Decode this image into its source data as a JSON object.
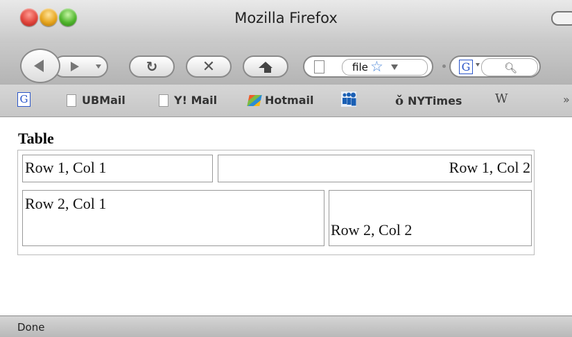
{
  "window": {
    "title": "Mozilla Firefox"
  },
  "toolbar": {
    "url_text": "file",
    "search_engine_glyph": "G",
    "icons": [
      "back-arrow-icon",
      "forward-arrow-icon",
      "reload-icon",
      "stop-icon",
      "home-icon",
      "bookmark-star-icon",
      "magnifier-icon"
    ]
  },
  "bookmarks": {
    "google_glyph": "G",
    "items": [
      {
        "label": "UBMail",
        "icon": "page-icon"
      },
      {
        "label": "Y! Mail",
        "icon": "page-icon"
      },
      {
        "label": "Hotmail",
        "icon": "windows-flag-icon"
      },
      {
        "label": "",
        "icon": "myspace-icon"
      },
      {
        "label": "NYTimes",
        "icon": "nyt-icon"
      },
      {
        "label": "",
        "icon": "wikipedia-icon"
      }
    ],
    "nyt_glyph": "ǒ",
    "wiki_glyph": "W",
    "overflow": "»"
  },
  "page": {
    "heading": "Table",
    "rows": [
      [
        "Row 1, Col 1",
        "Row 1, Col 2"
      ],
      [
        "Row 2, Col 1",
        "Row 2, Col 2"
      ]
    ]
  },
  "status": {
    "text": "Done"
  },
  "colors": {
    "google_blue": "#2a55c9",
    "star_blue": "#4a86d8"
  }
}
